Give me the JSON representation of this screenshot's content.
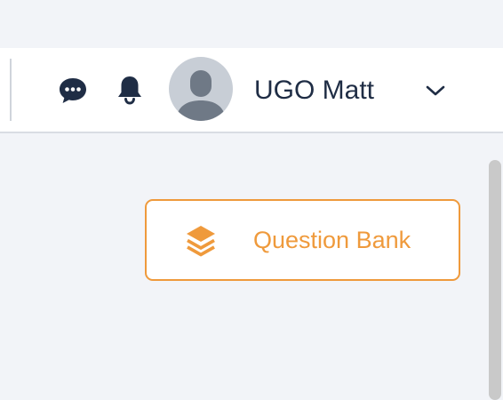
{
  "header": {
    "user_name": "UGO Matt",
    "chat_icon": "chat-bubble-icon",
    "bell_icon": "bell-icon",
    "chevron_icon": "chevron-down-icon",
    "avatar_icon": "user-avatar-icon"
  },
  "main": {
    "question_bank_label": "Question Bank",
    "question_bank_icon": "layers-icon"
  },
  "colors": {
    "accent": "#ef9a3c",
    "header_text": "#1f2d45",
    "page_background": "#f2f4f8"
  }
}
